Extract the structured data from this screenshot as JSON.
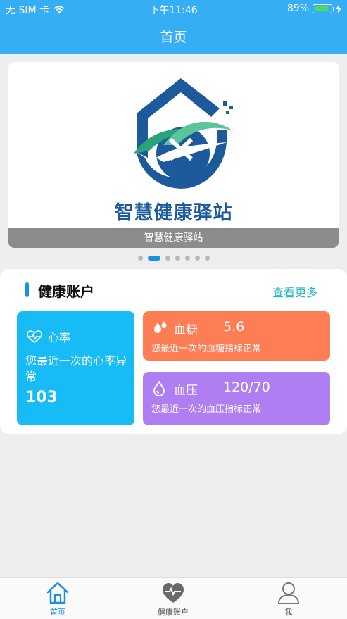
{
  "status_bar": {
    "carrier": "无 SIM 卡",
    "time": "下午11:46",
    "battery": "89%",
    "battery_level": 0.89
  },
  "nav": {
    "title": "首页"
  },
  "banner": {
    "logo_text": "智慧健康驿站",
    "caption": "智慧健康驿站",
    "slide_count": 7,
    "active_slide": 1
  },
  "health_account": {
    "title": "健康账户",
    "more": "查看更多",
    "heart_rate": {
      "label": "心率",
      "description": "您最近一次的心率异常",
      "value": "103"
    },
    "blood_sugar": {
      "label": "血糖",
      "value": "5.6",
      "description": "您最近一次的血糖指标正常"
    },
    "blood_pressure": {
      "label": "血压",
      "value": "120/70",
      "description": "您最近一次的血压指标正常"
    }
  },
  "tabbar": {
    "items": [
      {
        "label": "首页",
        "icon": "home-icon"
      },
      {
        "label": "健康账户",
        "icon": "heart-icon"
      },
      {
        "label": "我",
        "icon": "person-icon"
      }
    ]
  },
  "colors": {
    "primary": "#36aef5",
    "accent": "#1c8fe0",
    "heart_tile": "#17bbf5",
    "sugar_tile": "#fd7d55",
    "pressure_tile": "#b07ef3",
    "link": "#2ab5c8"
  }
}
